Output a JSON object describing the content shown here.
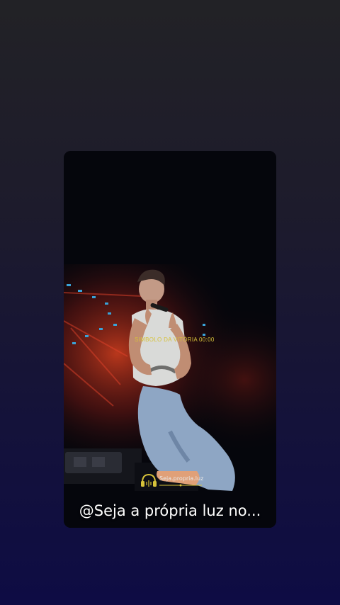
{
  "video": {
    "caption": "@Seja a própria luz no...",
    "overlay_text": "SIMBOLO DA VITÓRIA 00:00",
    "watermark": {
      "label": "Seja.propria.luz",
      "icon": "headphones-icon"
    }
  },
  "colors": {
    "background_top": "#222226",
    "background_bottom": "#0e0c44",
    "stage_red": "#c8321e",
    "watermark_yellow": "#d6c23a"
  }
}
